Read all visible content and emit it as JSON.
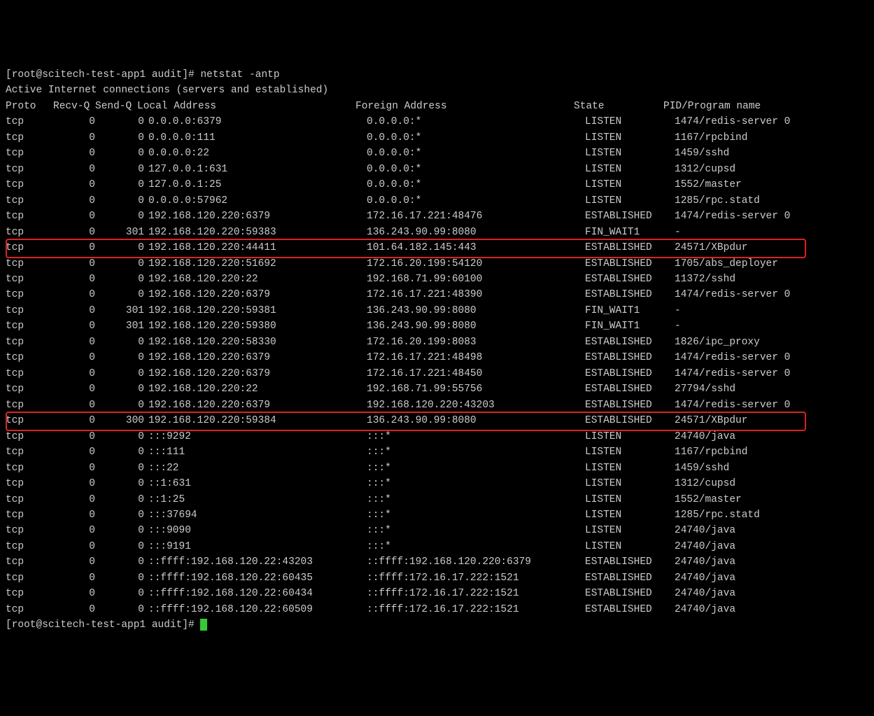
{
  "prompt1": "[root@scitech-test-app1 audit]# ",
  "command": "netstat -antp",
  "subtitle": "Active Internet connections (servers and established)",
  "header": {
    "proto": "Proto",
    "recvq": "Recv-Q",
    "sendq": "Send-Q",
    "local": "Local Address",
    "foreign": "Foreign Address",
    "state": "State",
    "prog": "PID/Program name"
  },
  "rows": [
    {
      "proto": "tcp",
      "recvq": "0",
      "sendq": "0",
      "local": "0.0.0.0:6379",
      "foreign": "0.0.0.0:*",
      "state": "LISTEN",
      "prog": "1474/redis-server 0"
    },
    {
      "proto": "tcp",
      "recvq": "0",
      "sendq": "0",
      "local": "0.0.0.0:111",
      "foreign": "0.0.0.0:*",
      "state": "LISTEN",
      "prog": "1167/rpcbind"
    },
    {
      "proto": "tcp",
      "recvq": "0",
      "sendq": "0",
      "local": "0.0.0.0:22",
      "foreign": "0.0.0.0:*",
      "state": "LISTEN",
      "prog": "1459/sshd"
    },
    {
      "proto": "tcp",
      "recvq": "0",
      "sendq": "0",
      "local": "127.0.0.1:631",
      "foreign": "0.0.0.0:*",
      "state": "LISTEN",
      "prog": "1312/cupsd"
    },
    {
      "proto": "tcp",
      "recvq": "0",
      "sendq": "0",
      "local": "127.0.0.1:25",
      "foreign": "0.0.0.0:*",
      "state": "LISTEN",
      "prog": "1552/master"
    },
    {
      "proto": "tcp",
      "recvq": "0",
      "sendq": "0",
      "local": "0.0.0.0:57962",
      "foreign": "0.0.0.0:*",
      "state": "LISTEN",
      "prog": "1285/rpc.statd"
    },
    {
      "proto": "tcp",
      "recvq": "0",
      "sendq": "0",
      "local": "192.168.120.220:6379",
      "foreign": "172.16.17.221:48476",
      "state": "ESTABLISHED",
      "prog": "1474/redis-server 0"
    },
    {
      "proto": "tcp",
      "recvq": "0",
      "sendq": "301",
      "local": "192.168.120.220:59383",
      "foreign": "136.243.90.99:8080",
      "state": "FIN_WAIT1",
      "prog": "-"
    },
    {
      "proto": "tcp",
      "recvq": "0",
      "sendq": "0",
      "local": "192.168.120.220:44411",
      "foreign": "101.64.182.145:443",
      "state": "ESTABLISHED",
      "prog": "24571/XBpdur",
      "hl": true
    },
    {
      "proto": "tcp",
      "recvq": "0",
      "sendq": "0",
      "local": "192.168.120.220:51692",
      "foreign": "172.16.20.199:54120",
      "state": "ESTABLISHED",
      "prog": "1705/abs_deployer"
    },
    {
      "proto": "tcp",
      "recvq": "0",
      "sendq": "0",
      "local": "192.168.120.220:22",
      "foreign": "192.168.71.99:60100",
      "state": "ESTABLISHED",
      "prog": "11372/sshd"
    },
    {
      "proto": "tcp",
      "recvq": "0",
      "sendq": "0",
      "local": "192.168.120.220:6379",
      "foreign": "172.16.17.221:48390",
      "state": "ESTABLISHED",
      "prog": "1474/redis-server 0"
    },
    {
      "proto": "tcp",
      "recvq": "0",
      "sendq": "301",
      "local": "192.168.120.220:59381",
      "foreign": "136.243.90.99:8080",
      "state": "FIN_WAIT1",
      "prog": "-"
    },
    {
      "proto": "tcp",
      "recvq": "0",
      "sendq": "301",
      "local": "192.168.120.220:59380",
      "foreign": "136.243.90.99:8080",
      "state": "FIN_WAIT1",
      "prog": "-"
    },
    {
      "proto": "tcp",
      "recvq": "0",
      "sendq": "0",
      "local": "192.168.120.220:58330",
      "foreign": "172.16.20.199:8083",
      "state": "ESTABLISHED",
      "prog": "1826/ipc_proxy"
    },
    {
      "proto": "tcp",
      "recvq": "0",
      "sendq": "0",
      "local": "192.168.120.220:6379",
      "foreign": "172.16.17.221:48498",
      "state": "ESTABLISHED",
      "prog": "1474/redis-server 0"
    },
    {
      "proto": "tcp",
      "recvq": "0",
      "sendq": "0",
      "local": "192.168.120.220:6379",
      "foreign": "172.16.17.221:48450",
      "state": "ESTABLISHED",
      "prog": "1474/redis-server 0"
    },
    {
      "proto": "tcp",
      "recvq": "0",
      "sendq": "0",
      "local": "192.168.120.220:22",
      "foreign": "192.168.71.99:55756",
      "state": "ESTABLISHED",
      "prog": "27794/sshd"
    },
    {
      "proto": "tcp",
      "recvq": "0",
      "sendq": "0",
      "local": "192.168.120.220:6379",
      "foreign": "192.168.120.220:43203",
      "state": "ESTABLISHED",
      "prog": "1474/redis-server 0"
    },
    {
      "proto": "tcp",
      "recvq": "0",
      "sendq": "300",
      "local": "192.168.120.220:59384",
      "foreign": "136.243.90.99:8080",
      "state": "ESTABLISHED",
      "prog": "24571/XBpdur",
      "hl": true
    },
    {
      "proto": "tcp",
      "recvq": "0",
      "sendq": "0",
      "local": ":::9292",
      "foreign": ":::*",
      "state": "LISTEN",
      "prog": "24740/java"
    },
    {
      "proto": "tcp",
      "recvq": "0",
      "sendq": "0",
      "local": ":::111",
      "foreign": ":::*",
      "state": "LISTEN",
      "prog": "1167/rpcbind"
    },
    {
      "proto": "tcp",
      "recvq": "0",
      "sendq": "0",
      "local": ":::22",
      "foreign": ":::*",
      "state": "LISTEN",
      "prog": "1459/sshd"
    },
    {
      "proto": "tcp",
      "recvq": "0",
      "sendq": "0",
      "local": "::1:631",
      "foreign": ":::*",
      "state": "LISTEN",
      "prog": "1312/cupsd"
    },
    {
      "proto": "tcp",
      "recvq": "0",
      "sendq": "0",
      "local": "::1:25",
      "foreign": ":::*",
      "state": "LISTEN",
      "prog": "1552/master"
    },
    {
      "proto": "tcp",
      "recvq": "0",
      "sendq": "0",
      "local": ":::37694",
      "foreign": ":::*",
      "state": "LISTEN",
      "prog": "1285/rpc.statd"
    },
    {
      "proto": "tcp",
      "recvq": "0",
      "sendq": "0",
      "local": ":::9090",
      "foreign": ":::*",
      "state": "LISTEN",
      "prog": "24740/java"
    },
    {
      "proto": "tcp",
      "recvq": "0",
      "sendq": "0",
      "local": ":::9191",
      "foreign": ":::*",
      "state": "LISTEN",
      "prog": "24740/java"
    },
    {
      "proto": "tcp",
      "recvq": "0",
      "sendq": "0",
      "local": "::ffff:192.168.120.22:43203",
      "foreign": "::ffff:192.168.120.220:6379",
      "state": "ESTABLISHED",
      "prog": "24740/java"
    },
    {
      "proto": "tcp",
      "recvq": "0",
      "sendq": "0",
      "local": "::ffff:192.168.120.22:60435",
      "foreign": "::ffff:172.16.17.222:1521",
      "state": "ESTABLISHED",
      "prog": "24740/java"
    },
    {
      "proto": "tcp",
      "recvq": "0",
      "sendq": "0",
      "local": "::ffff:192.168.120.22:60434",
      "foreign": "::ffff:172.16.17.222:1521",
      "state": "ESTABLISHED",
      "prog": "24740/java"
    },
    {
      "proto": "tcp",
      "recvq": "0",
      "sendq": "0",
      "local": "::ffff:192.168.120.22:60509",
      "foreign": "::ffff:172.16.17.222:1521",
      "state": "ESTABLISHED",
      "prog": "24740/java"
    }
  ],
  "prompt2": "[root@scitech-test-app1 audit]# "
}
